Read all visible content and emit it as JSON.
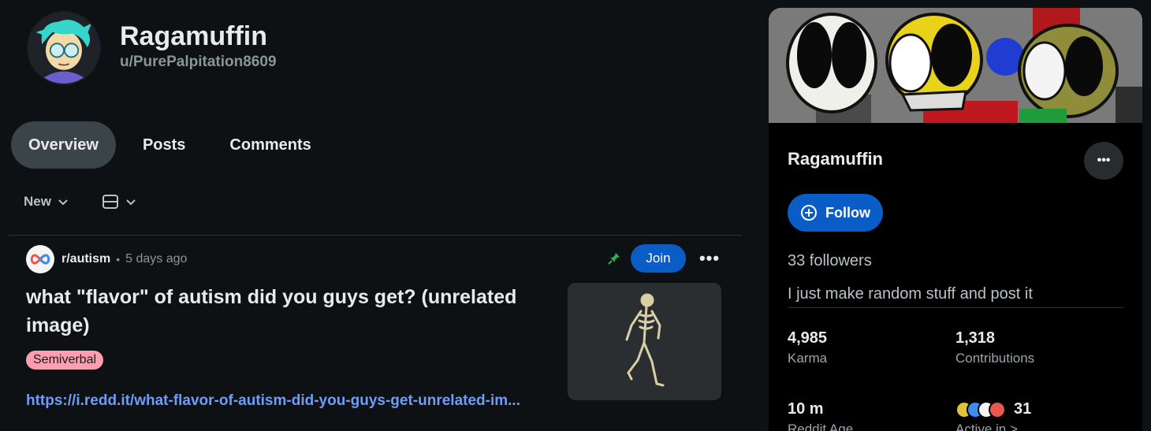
{
  "profile": {
    "display_name": "Ragamuffin",
    "username": "u/PurePalpitation8609"
  },
  "tabs": [
    {
      "label": "Overview",
      "active": true
    },
    {
      "label": "Posts",
      "active": false
    },
    {
      "label": "Comments",
      "active": false
    }
  ],
  "sort": {
    "label": "New",
    "view_icon": "view-card-icon"
  },
  "post": {
    "subreddit": "r/autism",
    "separator": "•",
    "time": "5 days ago",
    "join_label": "Join",
    "more_label": "•••",
    "title": "what \"flavor\" of autism did you guys get? (unrelated image)",
    "flair": "Semiverbal",
    "link": "https://i.redd.it/what-flavor-of-autism-did-you-guys-get-unrelated-im...",
    "pinned": true
  },
  "card": {
    "name": "Ragamuffin",
    "more_label": "•••",
    "follow_label": "Follow",
    "followers": "33 followers",
    "bio": "I just make random stuff and post it",
    "stats": [
      {
        "value": "4,985",
        "label": "Karma"
      },
      {
        "value": "1,318",
        "label": "Contributions"
      },
      {
        "value": "10 m",
        "label": "Reddit Age"
      },
      {
        "value": "31",
        "label": "Active in >"
      }
    ]
  },
  "colors": {
    "background": "#0e1113",
    "accent_blue": "#0a5cc7",
    "link_blue": "#6e9cf7",
    "flair_pink": "#ff9eb0",
    "tab_active": "#3a4449"
  }
}
